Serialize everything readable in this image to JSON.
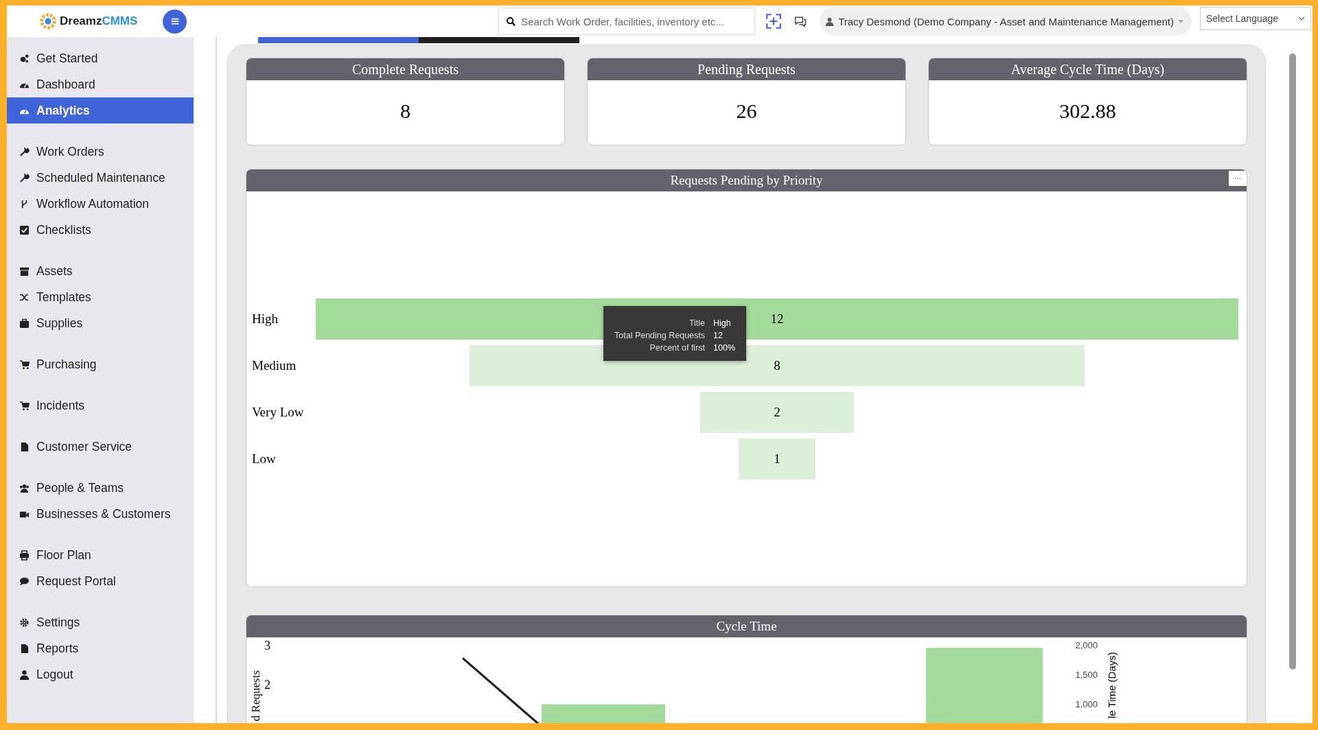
{
  "logo": {
    "text_main": "Dreamz",
    "text_accent": "CMMS"
  },
  "search": {
    "placeholder": "Search Work Order, facilities, inventory etc..."
  },
  "user": {
    "name": "Tracy Desmond (Demo Company - Asset and Maintenance Management)"
  },
  "language": {
    "value": "Select Language"
  },
  "sidebar": {
    "groups": [
      [
        {
          "label": "Get Started",
          "selected": false
        },
        {
          "label": "Dashboard",
          "selected": false
        },
        {
          "label": "Analytics",
          "selected": true
        }
      ],
      [
        {
          "label": "Work Orders",
          "selected": false
        },
        {
          "label": "Scheduled Maintenance",
          "selected": false
        },
        {
          "label": "Workflow Automation",
          "selected": false
        },
        {
          "label": "Checklists",
          "selected": false
        }
      ],
      [
        {
          "label": "Assets",
          "selected": false
        },
        {
          "label": "Templates",
          "selected": false
        },
        {
          "label": "Supplies",
          "selected": false
        }
      ],
      [
        {
          "label": "Purchasing",
          "selected": false
        }
      ],
      [
        {
          "label": "Incidents",
          "selected": false
        }
      ],
      [
        {
          "label": "Customer Service",
          "selected": false
        }
      ],
      [
        {
          "label": "People & Teams",
          "selected": false
        },
        {
          "label": "Businesses & Customers",
          "selected": false
        }
      ],
      [
        {
          "label": "Floor Plan",
          "selected": false
        },
        {
          "label": "Request Portal",
          "selected": false
        }
      ],
      [
        {
          "label": "Settings",
          "selected": false
        },
        {
          "label": "Reports",
          "selected": false
        },
        {
          "label": "Logout",
          "selected": false
        }
      ]
    ]
  },
  "stats": [
    {
      "title": "Complete Requests",
      "value": "8"
    },
    {
      "title": "Pending Requests",
      "value": "26"
    },
    {
      "title": "Average Cycle Time (Days)",
      "value": "302.88"
    }
  ],
  "funnel": {
    "title": "Requests Pending by Priority",
    "rows": [
      {
        "label": "High",
        "value": "12",
        "selected": true
      },
      {
        "label": "Medium",
        "value": "8",
        "selected": false
      },
      {
        "label": "Very Low",
        "value": "2",
        "selected": false
      },
      {
        "label": "Low",
        "value": "1",
        "selected": false
      }
    ],
    "tooltip": {
      "rows": [
        {
          "label": "Title",
          "value": "High"
        },
        {
          "label": "Total Pending Requests",
          "value": "12"
        },
        {
          "label": "Percent of first",
          "value": "100%"
        }
      ]
    }
  },
  "cycle": {
    "title": "Cycle Time",
    "left_axis_label": "d Requests",
    "left_ticks": [
      "3",
      "2"
    ],
    "right_axis_label": "le Time (Days)",
    "right_ticks": [
      "2,000",
      "1,500",
      "1,000"
    ]
  }
}
